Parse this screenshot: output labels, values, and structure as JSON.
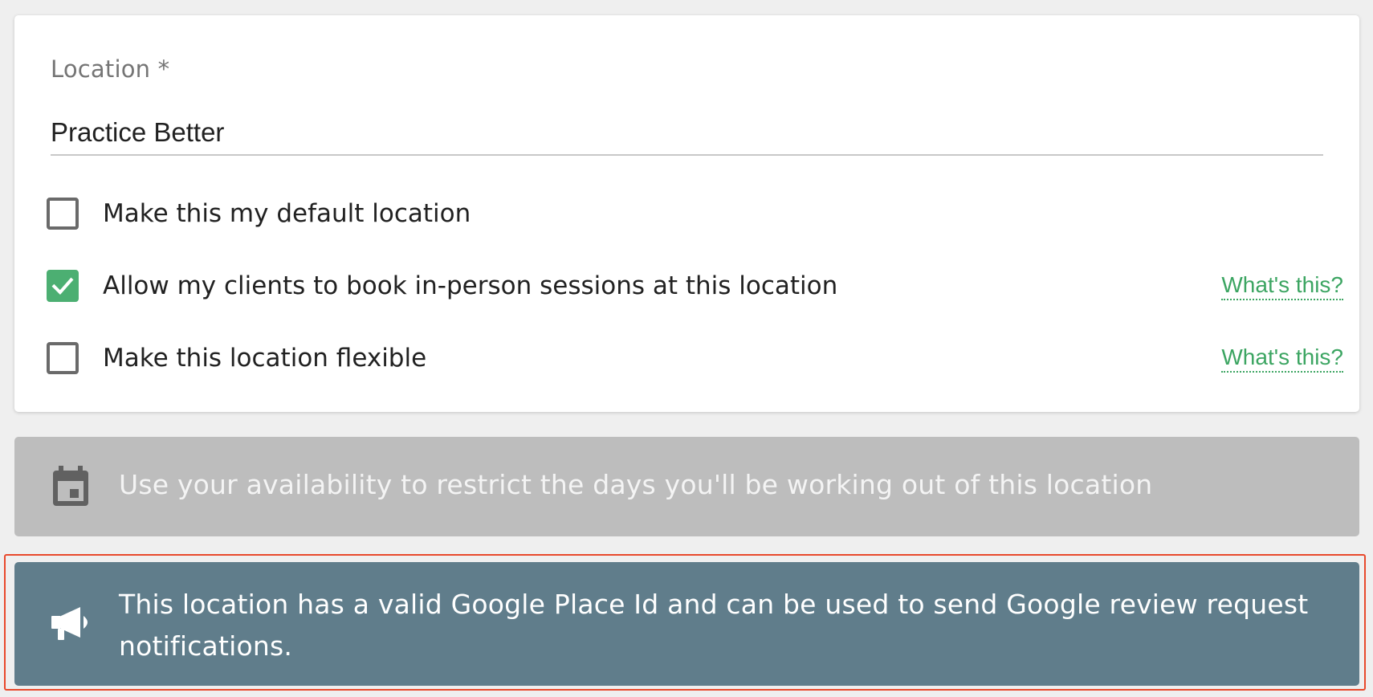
{
  "location_form": {
    "label": "Location *",
    "value": "Practice Better",
    "options": [
      {
        "label": "Make this my default location",
        "checked": false,
        "help_link": ""
      },
      {
        "label": "Allow my clients to book in-person sessions at this location",
        "checked": true,
        "help_link": "What's this?"
      },
      {
        "label": "Make this location flexible",
        "checked": false,
        "help_link": "What's this?"
      }
    ]
  },
  "availability_banner": {
    "icon": "calendar-icon",
    "text": "Use your availability to restrict the days you'll be working out of this location"
  },
  "google_banner": {
    "icon": "megaphone-icon",
    "text": "This location has a valid Google Place Id and can be used to send Google review request notifications."
  },
  "colors": {
    "accent_green": "#4caf72",
    "link_green": "#3ca562",
    "banner_gray": "#bdbdbd",
    "banner_blue": "#607d8b",
    "highlight_red": "#e8492c"
  }
}
